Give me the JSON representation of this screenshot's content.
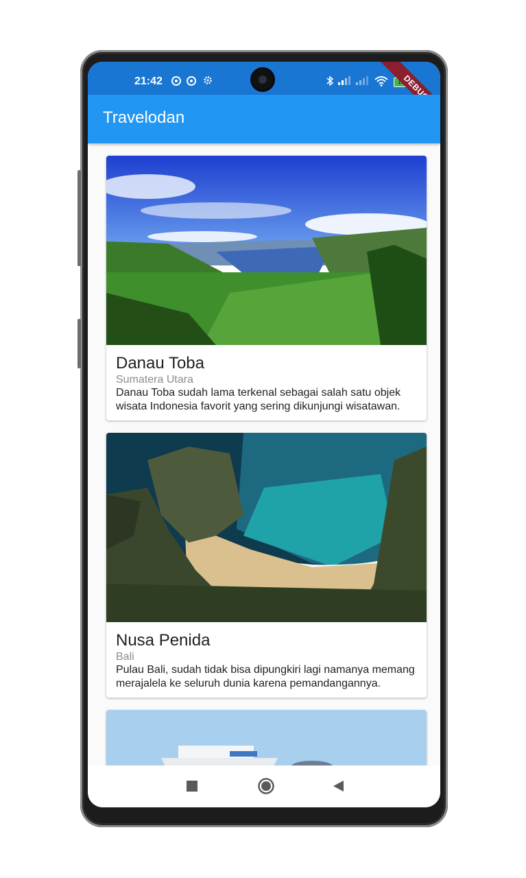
{
  "status_bar": {
    "time": "21:42",
    "battery": "100",
    "debug_banner": "DEBUG",
    "icons": [
      "sync-icon",
      "sync-icon",
      "gear-icon",
      "bluetooth-icon",
      "signal-icon",
      "signal-icon",
      "wifi-icon",
      "battery-icon"
    ]
  },
  "app_bar": {
    "title": "Travelodan"
  },
  "places": [
    {
      "name": "Danau Toba",
      "location": "Sumatera Utara",
      "description": "Danau Toba sudah lama terkenal sebagai salah satu objek wisata Indonesia favorit yang sering dikunjungi wisatawan."
    },
    {
      "name": "Nusa Penida",
      "location": "Bali",
      "description": "Pulau Bali, sudah tidak bisa dipungkiri lagi namanya memang merajalela ke seluruh dunia karena pemandangannya."
    }
  ],
  "nav_bar": {
    "icons": [
      "recents-icon",
      "home-icon",
      "back-icon"
    ]
  },
  "colors": {
    "primary": "#2196f3",
    "status_bar": "#1976d2",
    "debug": "#8b1e2f"
  }
}
